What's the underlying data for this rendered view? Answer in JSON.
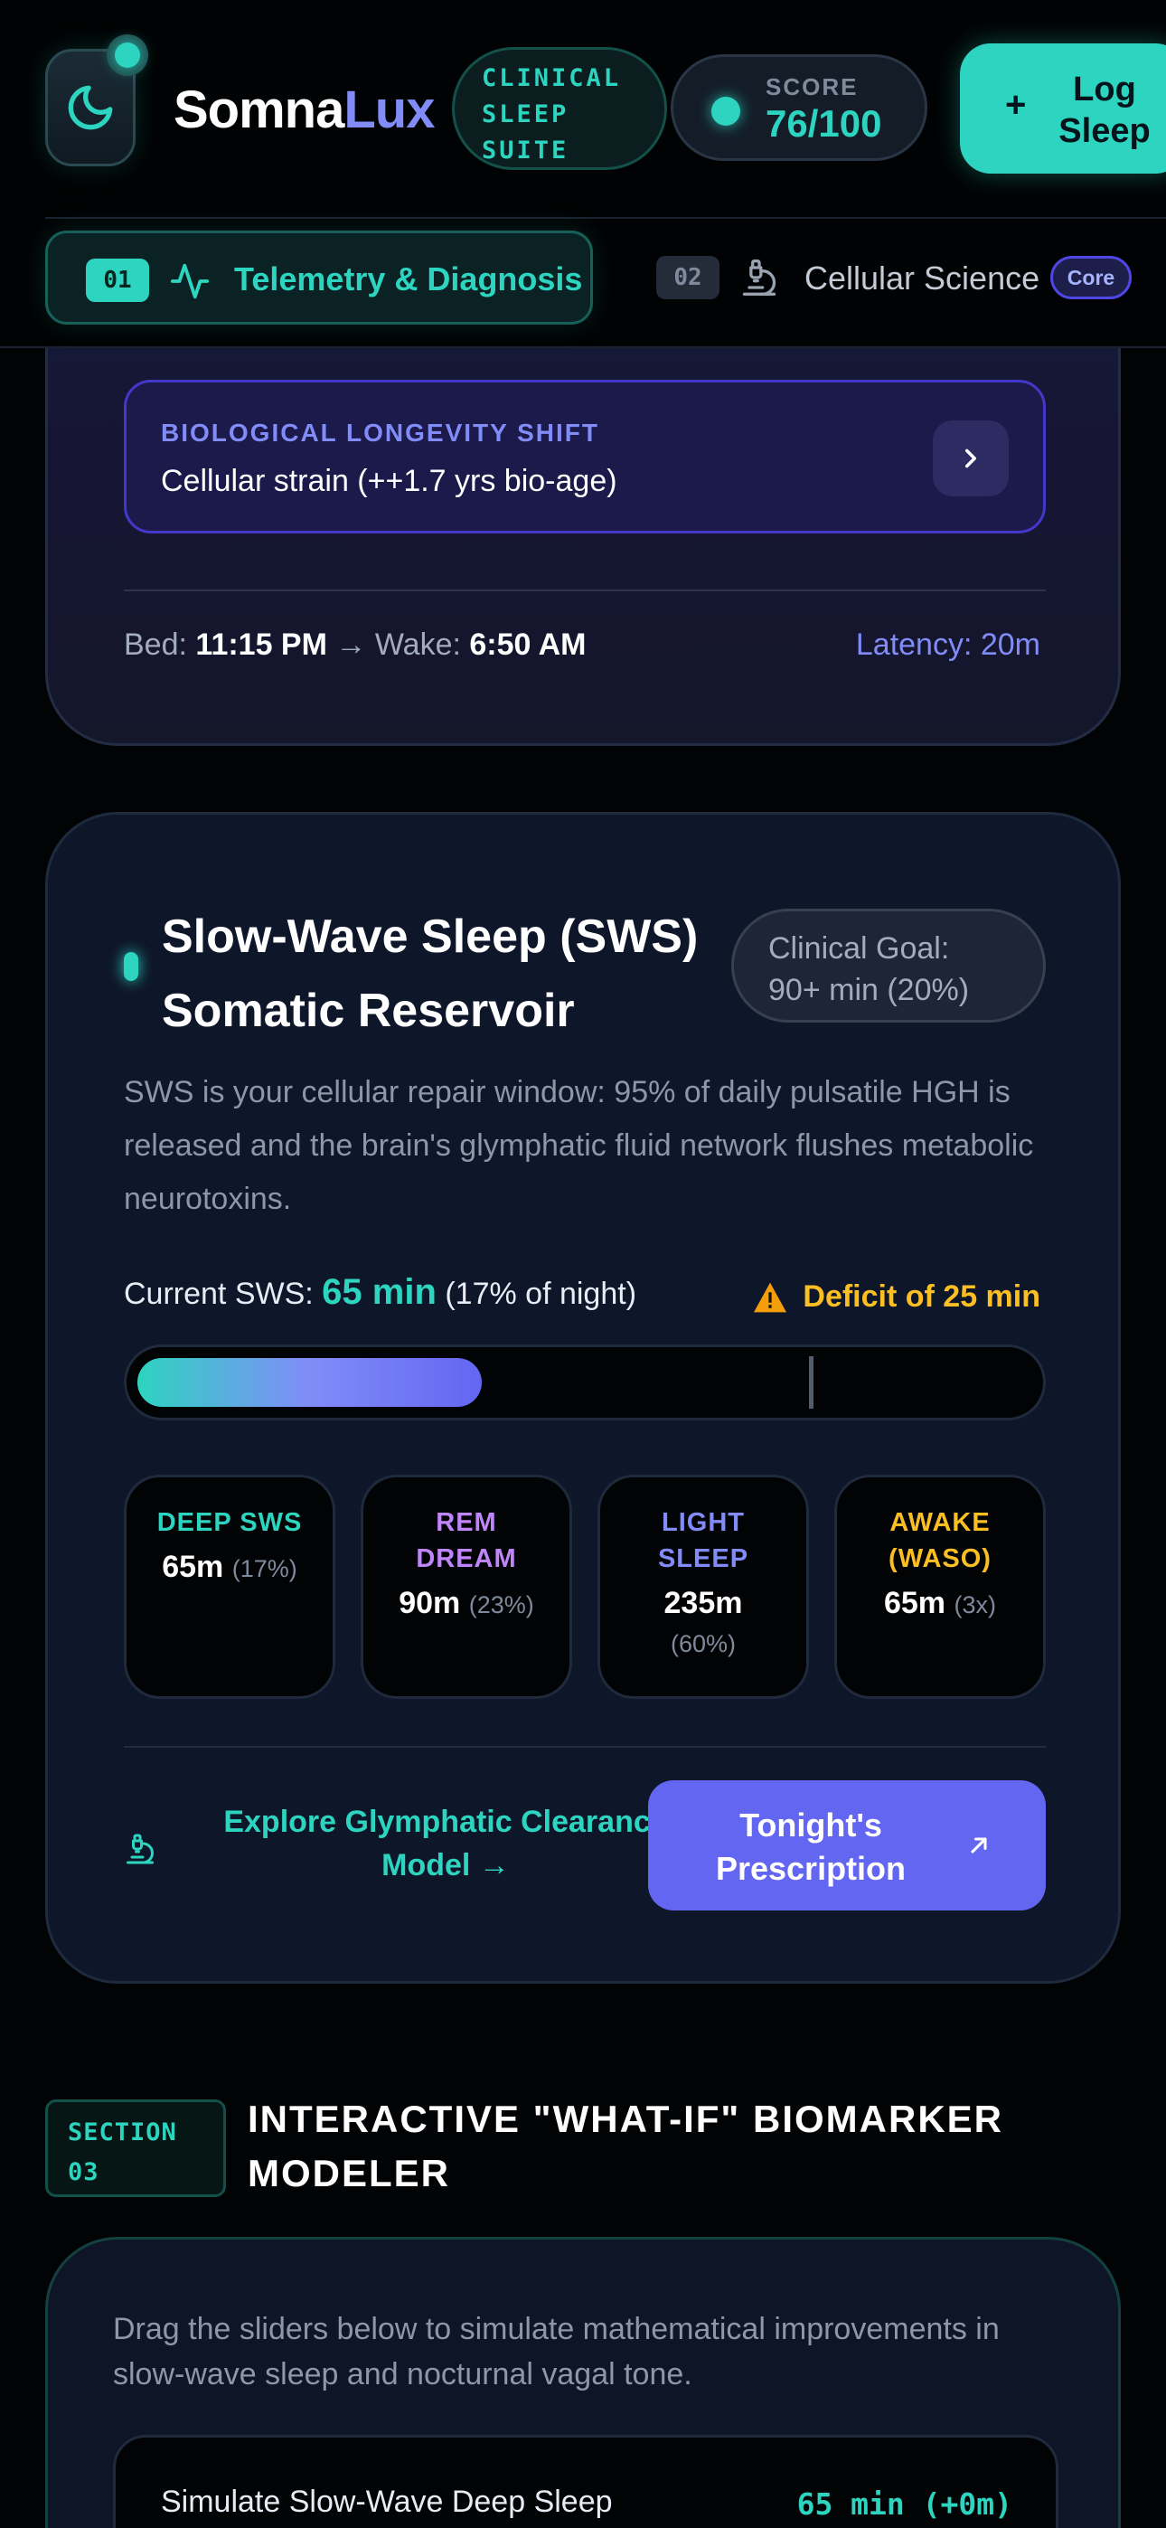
{
  "header": {
    "brand_part1": "Somna",
    "brand_part2": "Lux",
    "suite_line1": "CLINICAL",
    "suite_line2": "SLEEP",
    "suite_line3": "SUITE",
    "score_label": "SCORE",
    "score_value": "76/100",
    "log_plus": "+",
    "log_line1": "Log",
    "log_line2": "Sleep"
  },
  "tabs": [
    {
      "num": "01",
      "label": "Telemetry & Diagnosis",
      "icon": "activity-icon",
      "active": true
    },
    {
      "num": "02",
      "label": "Cellular Science",
      "icon": "microscope-icon",
      "badge": "Core",
      "active": false
    }
  ],
  "top_card": {
    "shift_title": "BIOLOGICAL LONGEVITY SHIFT",
    "shift_desc": "Cellular strain (++1.7 yrs bio-age)",
    "bed_label": "Bed:",
    "bed_time": "11:15 PM",
    "arrow": "→",
    "wake_label": "Wake:",
    "wake_time": "6:50 AM",
    "latency": "Latency: 20m"
  },
  "sws_card": {
    "title_line1": "Slow-Wave Sleep (SWS)",
    "title_line2": "Somatic Reservoir",
    "goal_line1": "Clinical Goal:",
    "goal_line2": "90+ min (20%)",
    "description": "SWS is your cellular repair window: 95% of daily pulsatile HGH is released and the brain's glymphatic fluid network flushes metabolic neurotoxins.",
    "current_label": "Current SWS:",
    "current_value": "65 min",
    "current_pct": "(17% of night)",
    "deficit": "Deficit of 25 min",
    "progress": {
      "current_min": 65,
      "goal_min": 90,
      "scale_max_min": 120
    },
    "stages": [
      {
        "name_line1": "DEEP SWS",
        "name_line2": "",
        "value": "65m",
        "pct": "(17%)",
        "color": "#2dd4bf"
      },
      {
        "name_line1": "REM",
        "name_line2": "DREAM",
        "value": "90m",
        "pct": "(23%)",
        "color": "#c084fc"
      },
      {
        "name_line1": "LIGHT",
        "name_line2": "SLEEP",
        "value": "235m",
        "pct": "(60%)",
        "color": "#818cf8"
      },
      {
        "name_line1": "AWAKE",
        "name_line2": "(WASO)",
        "value": "65m",
        "pct": "(3x)",
        "color": "#fbbf24"
      }
    ],
    "explore_line1": "Explore Glymphatic Clearance",
    "explore_line2": "Model →",
    "rx_line1": "Tonight's",
    "rx_line2": "Prescription"
  },
  "section3": {
    "badge_line1": "SECTION",
    "badge_line2": "03",
    "title_line1": "INTERACTIVE \"WHAT-IF\" BIOMARKER",
    "title_line2": "MODELER",
    "description": "Drag the sliders below to simulate mathematical improvements in slow-wave sleep and nocturnal vagal tone.",
    "slider_label": "Simulate Slow-Wave Deep Sleep",
    "slider_value": "65 min (+0m)"
  },
  "colors": {
    "accent_teal": "#2dd4bf",
    "accent_indigo": "#6366f1",
    "lavender": "#818cf8",
    "warning": "#fbbf24",
    "background": "#020305"
  }
}
